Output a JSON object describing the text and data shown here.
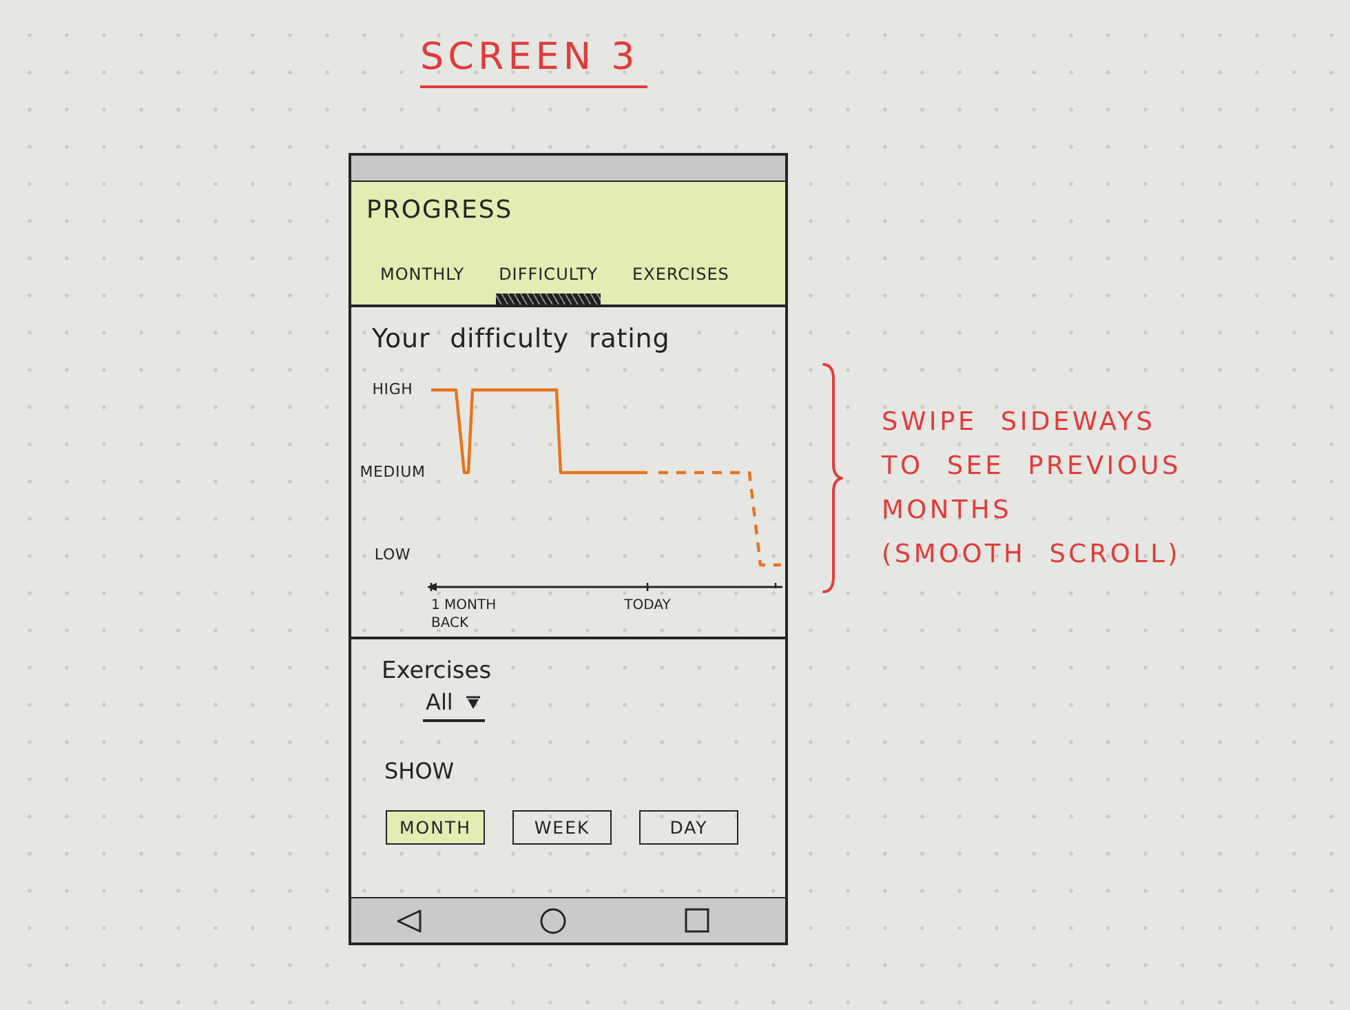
{
  "title": "SCREEN 3",
  "phone": {
    "header": {
      "title": "PROGRESS",
      "tabs": [
        {
          "label": "MONTHLY",
          "selected": false
        },
        {
          "label": "DIFFICULTY",
          "selected": true
        },
        {
          "label": "EXERCISES",
          "selected": false
        }
      ]
    },
    "rating": {
      "title": "Your difficulty rating",
      "y_axis_labels": [
        "HIGH",
        "MEDIUM",
        "LOW"
      ],
      "x_axis_labels": [
        "1 MONTH BACK",
        "TODAY"
      ]
    },
    "exercises": {
      "label": "Exercises",
      "value": "All"
    },
    "show": {
      "label": "SHOW",
      "options": [
        {
          "label": "MONTH",
          "selected": true
        },
        {
          "label": "WEEK",
          "selected": false
        },
        {
          "label": "DAY",
          "selected": false
        }
      ]
    }
  },
  "annotation": "SWIPE SIDEWAYS\nTO SEE PREVIOUS\nMONTHS\n(SMOOTH SCROLL)"
}
